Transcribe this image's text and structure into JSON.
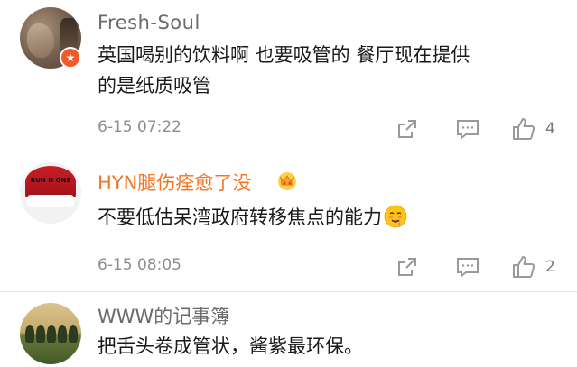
{
  "comments": [
    {
      "username": "Fresh-Soul",
      "content_line1": "英国喝别的饮料啊 也要吸管的 餐厅现在提供",
      "content_line2": "的是纸质吸管",
      "time": "6-15 07:22",
      "likes": "4",
      "badge_icon": "star-badge-icon"
    },
    {
      "username": "HYN腿伤痊愈了没",
      "content": "不要低估呆湾政府转移焦点的能力",
      "time": "6-15 08:05",
      "likes": "2",
      "avatar_text": "RUN N ONE",
      "emoji_icon": "drooling-face-emoji"
    },
    {
      "username": "WWW的记事簿",
      "content": "把舌头卷成管状，酱紫最环保。"
    }
  ],
  "colors": {
    "vip_username": "#f47521",
    "username": "#6b6b6b",
    "text": "#1a1a1a",
    "meta": "#8e8e8e",
    "divider": "#e6e6e6"
  }
}
